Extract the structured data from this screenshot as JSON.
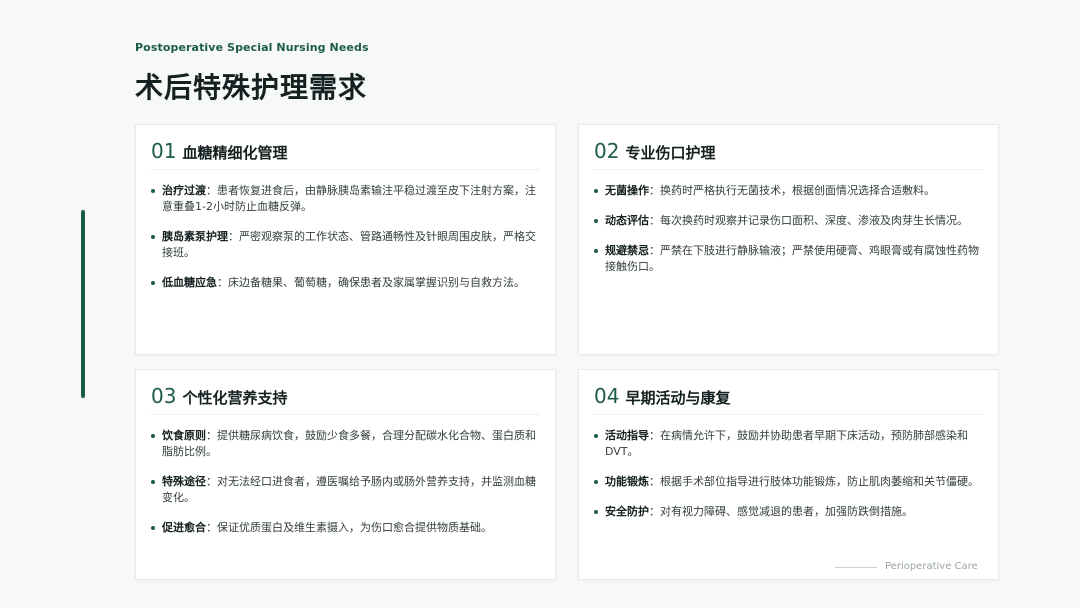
{
  "header": {
    "subtitle": "Postoperative Special Nursing Needs",
    "title": "术后特殊护理需求"
  },
  "cards": [
    {
      "num": "01",
      "title": "血糖精细化管理",
      "items": [
        {
          "key": "治疗过渡",
          "text": "：患者恢复进食后，由静脉胰岛素输注平稳过渡至皮下注射方案，注意重叠1-2小时防止血糖反弹。"
        },
        {
          "key": "胰岛素泵护理",
          "text": "：严密观察泵的工作状态、管路通畅性及针眼周围皮肤，严格交接班。"
        },
        {
          "key": "低血糖应急",
          "text": "：床边备糖果、葡萄糖，确保患者及家属掌握识别与自救方法。"
        }
      ]
    },
    {
      "num": "02",
      "title": "专业伤口护理",
      "items": [
        {
          "key": "无菌操作",
          "text": "：换药时严格执行无菌技术，根据创面情况选择合适敷料。"
        },
        {
          "key": "动态评估",
          "text": "：每次换药时观察并记录伤口面积、深度、渗液及肉芽生长情况。"
        },
        {
          "key": "规避禁忌",
          "text": "：严禁在下肢进行静脉输液；严禁使用硬膏、鸡眼膏或有腐蚀性药物接触伤口。"
        }
      ]
    },
    {
      "num": "03",
      "title": "个性化营养支持",
      "items": [
        {
          "key": "饮食原则",
          "text": "：提供糖尿病饮食，鼓励少食多餐，合理分配碳水化合物、蛋白质和脂肪比例。"
        },
        {
          "key": "特殊途径",
          "text": "：对无法经口进食者，遵医嘱给予肠内或肠外营养支持，并监测血糖变化。"
        },
        {
          "key": "促进愈合",
          "text": "：保证优质蛋白及维生素摄入，为伤口愈合提供物质基础。"
        }
      ]
    },
    {
      "num": "04",
      "title": "早期活动与康复",
      "items": [
        {
          "key": "活动指导",
          "text": "：在病情允许下，鼓励并协助患者早期下床活动，预防肺部感染和DVT。"
        },
        {
          "key": "功能锻炼",
          "text": "：根据手术部位指导进行肢体功能锻炼，防止肌肉萎缩和关节僵硬。"
        },
        {
          "key": "安全防护",
          "text": "：对有视力障碍、感觉减退的患者，加强防跌倒措施。"
        }
      ]
    }
  ],
  "footer": {
    "text": "Perioperative Care"
  },
  "colors": {
    "accent": "#1d5c4a",
    "background": "#f7f8f8",
    "card": "#ffffff"
  }
}
